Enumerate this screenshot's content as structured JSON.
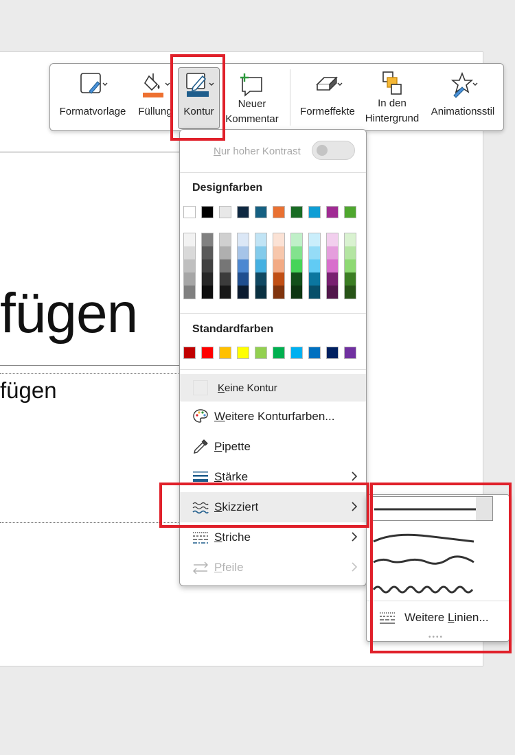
{
  "slide": {
    "title_fragment": "fügen",
    "subtitle_fragment": "fügen"
  },
  "toolbar": {
    "buttons": [
      {
        "id": "formatvorlage",
        "label": "Formatvorlage",
        "icon": "shape-style-icon",
        "has_dropdown": true
      },
      {
        "id": "fuellung",
        "label": "Füllung",
        "icon": "paint-bucket-icon",
        "has_dropdown": true,
        "accent_color": "#ed7030"
      },
      {
        "id": "kontur",
        "label": "Kontur",
        "icon": "pen-outline-icon",
        "has_dropdown": true,
        "selected": true,
        "accent_color": "#1f5d8c"
      },
      {
        "id": "neuer_kommentar",
        "label_line1": "Neuer",
        "label_line2": "Kommentar",
        "icon": "new-comment-icon"
      },
      {
        "id": "formeffekte",
        "label": "Formeffekte",
        "icon": "shape-effects-icon",
        "has_dropdown": true
      },
      {
        "id": "in_den_hintergrund",
        "label_line1": "In den",
        "label_line2": "Hintergrund",
        "icon": "send-backward-icon"
      },
      {
        "id": "animationsstil",
        "label": "Animationsstil",
        "icon": "animation-star-icon",
        "has_dropdown": true
      }
    ]
  },
  "menu": {
    "high_contrast_prefix": "N",
    "high_contrast_rest": "ur hoher Kontrast",
    "high_contrast_enabled": false,
    "design_colors_title": "Designfarben",
    "design_colors_top": [
      "#ffffff",
      "#000000",
      "#e8e8e8",
      "#0e2841",
      "#156082",
      "#e97132",
      "#196b24",
      "#0f9ed5",
      "#a02b93",
      "#4ea72e"
    ],
    "design_color_shades": [
      [
        "#f2f2f2",
        "#d9d9d9",
        "#bfbfbf",
        "#a6a6a6",
        "#808080"
      ],
      [
        "#808080",
        "#595959",
        "#404040",
        "#262626",
        "#0d0d0d"
      ],
      [
        "#d0d0d0",
        "#afafaf",
        "#767676",
        "#3b3b3b",
        "#171717"
      ],
      [
        "#dbe7f6",
        "#a6c4e8",
        "#4d88d1",
        "#1f4e8f",
        "#0a1a2f"
      ],
      [
        "#c1e4f5",
        "#83cbeb",
        "#45b0e1",
        "#104862",
        "#0a3041"
      ],
      [
        "#fbe2d5",
        "#f7c7ac",
        "#f2aa84",
        "#c04f15",
        "#80340e"
      ],
      [
        "#c0f0c8",
        "#83e28e",
        "#47d459",
        "#124f1a",
        "#0c3511"
      ],
      [
        "#caeefb",
        "#95dcf7",
        "#61cbf4",
        "#0b769f",
        "#074f6a"
      ],
      [
        "#f2cfee",
        "#e59edd",
        "#d86ecc",
        "#782070",
        "#51164b"
      ],
      [
        "#d9f2d0",
        "#b4e5a2",
        "#8ed973",
        "#3b7d23",
        "#275317"
      ]
    ],
    "standard_colors_title": "Standardfarben",
    "standard_colors": [
      "#c00000",
      "#ff0000",
      "#ffc000",
      "#ffff00",
      "#92d050",
      "#00b050",
      "#00b0f0",
      "#0070c0",
      "#002060",
      "#7030a0"
    ],
    "no_outline_prefix": "K",
    "no_outline_rest": "eine Kontur",
    "items": [
      {
        "prefix": "W",
        "rest": "eitere Konturfarben...",
        "icon": "palette-icon",
        "has_submenu": false,
        "disabled": false
      },
      {
        "prefix": "P",
        "rest": "ipette",
        "icon": "eyedropper-icon",
        "has_submenu": false,
        "disabled": false
      },
      {
        "prefix": "S",
        "rest": "tärke",
        "icon": "line-weight-icon",
        "has_submenu": true,
        "disabled": false
      },
      {
        "prefix": "S",
        "rest": "kizziert",
        "icon": "sketched-line-icon",
        "has_submenu": true,
        "disabled": false,
        "highlighted": true
      },
      {
        "prefix": "S",
        "rest": "triche",
        "icon": "dashes-icon",
        "has_submenu": true,
        "disabled": false
      },
      {
        "prefix": "P",
        "rest": "feile",
        "icon": "arrows-icon",
        "has_submenu": true,
        "disabled": true
      }
    ]
  },
  "submenu": {
    "options": [
      "straight",
      "curved",
      "freehand",
      "scribble"
    ],
    "selected_option": "straight",
    "more_lines_prefix": "Weitere ",
    "more_lines_underlined": "L",
    "more_lines_rest": "inien..."
  },
  "colors": {
    "highlight_red": "#e0202a",
    "accent_orange": "#ed7030",
    "accent_blue": "#1f5d8c"
  }
}
